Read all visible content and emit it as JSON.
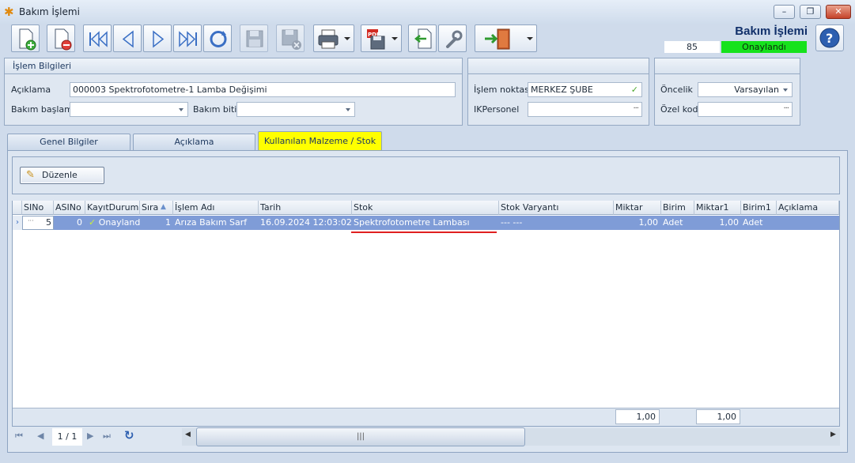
{
  "window": {
    "title": "Bakım İşlemi",
    "minimize": "–",
    "restore": "❐",
    "close": "✕"
  },
  "header": {
    "title": "Bakım İşlemi",
    "record_no": "85",
    "status": "Onaylandı",
    "status_color": "#16e21c"
  },
  "toolbar": {
    "icons": [
      "new-document-icon",
      "delete-document-icon",
      "first-record-icon",
      "previous-record-icon",
      "next-record-icon",
      "last-record-icon",
      "refresh-icon",
      "save-icon",
      "cancel-save-icon",
      "print-icon",
      "pdf-export-icon",
      "import-icon",
      "tools-icon",
      "exit-door-icon",
      "help-icon"
    ],
    "pdf_label": "PDF"
  },
  "islem_bilgileri": {
    "title": "İşlem Bilgileri",
    "aciklama_label": "Açıklama",
    "aciklama_value": "000003 Spektrofotometre-1 Lamba Değişimi",
    "bakim_baslama_label": "Bakım başlama",
    "bakim_baslama_value": " .  .       :  :",
    "bakim_bitis_label": "Bakım bitiş",
    "bakim_bitis_value": " .  .       :  :"
  },
  "location_group": {
    "islem_noktasi_label": "İşlem noktası",
    "islem_noktasi_value": "MERKEZ ŞUBE",
    "ikpersonel_label": "IKPersonel",
    "ikpersonel_value": ""
  },
  "priority_group": {
    "oncelik_label": "Öncelik",
    "oncelik_value": "Varsayılan",
    "ozel_kod_label": "Özel kod",
    "ozel_kod_value": ""
  },
  "tabs": [
    {
      "label": "Genel Bilgiler",
      "active": false
    },
    {
      "label": "Açıklama",
      "active": false
    },
    {
      "label": "Kullanılan Malzeme / Stok",
      "active": true
    }
  ],
  "edit_button": "Düzenle",
  "grid": {
    "columns": [
      "SINo",
      "ASINo",
      "KayıtDurumu",
      "Sıra",
      "İşlem Adı",
      "Tarih",
      "Stok",
      "Stok Varyantı",
      "Miktar",
      "Birim",
      "Miktar1",
      "Birim1",
      "Açıklama"
    ],
    "rows": [
      {
        "SIMarker": "···",
        "SINo": "5",
        "ASINo": "0",
        "KayitDurumu": "Onaylandı",
        "Sira": "1",
        "IslemAdi": "Arıza Bakım Sarf",
        "Tarih": "16.09.2024 12:03:02",
        "Stok": "Spektrofotometre Lambası",
        "StokVaryanti": "--- ---",
        "Miktar": "1,00",
        "Birim": "Adet",
        "Miktar1": "1,00",
        "Birim1": "Adet",
        "Aciklama": ""
      }
    ],
    "totals": {
      "miktar": "1,00",
      "miktar1": "1,00"
    },
    "selected_row_color": "#7f9cd7",
    "highlight_underline_color": "#e02020"
  },
  "navigator": {
    "page": "1 / 1"
  },
  "scrollbar_grip": "|||"
}
